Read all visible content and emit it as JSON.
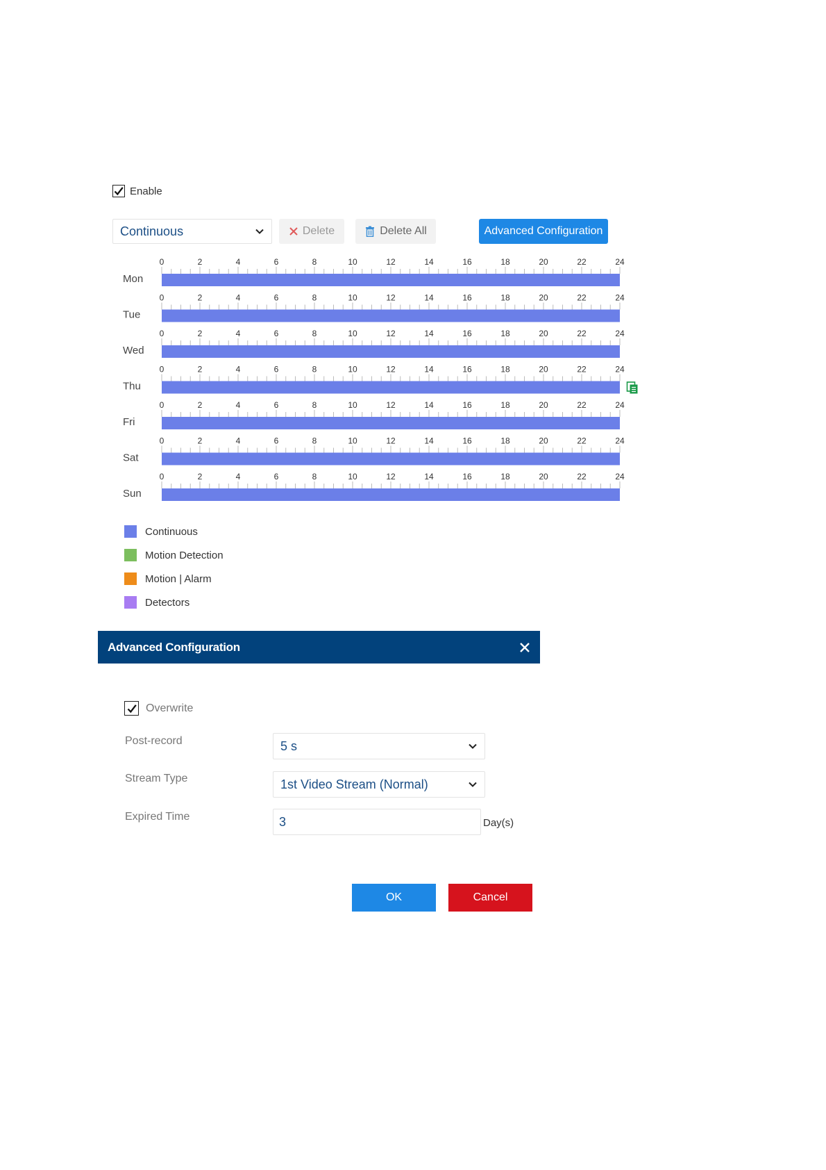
{
  "schedule": {
    "enable_label": "Enable",
    "enable_checked": true,
    "mode_value": "Continuous",
    "delete_label": "Delete",
    "delete_all_label": "Delete All",
    "advanced_button_label": "Advanced Configuration",
    "hour_ticks": [
      "0",
      "2",
      "4",
      "6",
      "8",
      "10",
      "12",
      "14",
      "16",
      "18",
      "20",
      "22",
      "24"
    ],
    "days": [
      {
        "label": "Mon",
        "segments": [
          {
            "start": 0,
            "end": 24,
            "type": "Continuous"
          }
        ]
      },
      {
        "label": "Tue",
        "segments": [
          {
            "start": 0,
            "end": 24,
            "type": "Continuous"
          }
        ]
      },
      {
        "label": "Wed",
        "segments": [
          {
            "start": 0,
            "end": 24,
            "type": "Continuous"
          }
        ]
      },
      {
        "label": "Thu",
        "segments": [
          {
            "start": 0,
            "end": 24,
            "type": "Continuous"
          }
        ],
        "copy_icon": true
      },
      {
        "label": "Fri",
        "segments": [
          {
            "start": 0,
            "end": 24,
            "type": "Continuous"
          }
        ]
      },
      {
        "label": "Sat",
        "segments": [
          {
            "start": 0,
            "end": 24,
            "type": "Continuous"
          }
        ]
      },
      {
        "label": "Sun",
        "segments": [
          {
            "start": 0,
            "end": 24,
            "type": "Continuous"
          }
        ]
      }
    ]
  },
  "legend": [
    {
      "label": "Continuous",
      "color": "#6b7fe8"
    },
    {
      "label": "Motion Detection",
      "color": "#7cbe5e"
    },
    {
      "label": "Motion | Alarm",
      "color": "#ee8c1a"
    },
    {
      "label": "Detectors",
      "color": "#a87cf2"
    }
  ],
  "dialog": {
    "title": "Advanced Configuration",
    "overwrite_label": "Overwrite",
    "overwrite_checked": true,
    "post_record_label": "Post-record",
    "post_record_value": "5 s",
    "stream_type_label": "Stream Type",
    "stream_type_value": "1st Video Stream (Normal)",
    "expired_time_label": "Expired Time",
    "expired_time_value": "3",
    "expired_time_unit": "Day(s)",
    "ok_label": "OK",
    "cancel_label": "Cancel"
  },
  "colors": {
    "accent": "#1e88e5",
    "header_bg": "#02427c",
    "cancel": "#d6131d",
    "bar": "#6b7fe8",
    "copy_icon": "#1a9a48"
  },
  "icons": {
    "delete": "close-x-icon",
    "delete_all": "trash-icon",
    "copy": "copy-icon",
    "dropdown": "chevron-down-icon",
    "close": "close-icon",
    "check": "checkmark-icon"
  }
}
